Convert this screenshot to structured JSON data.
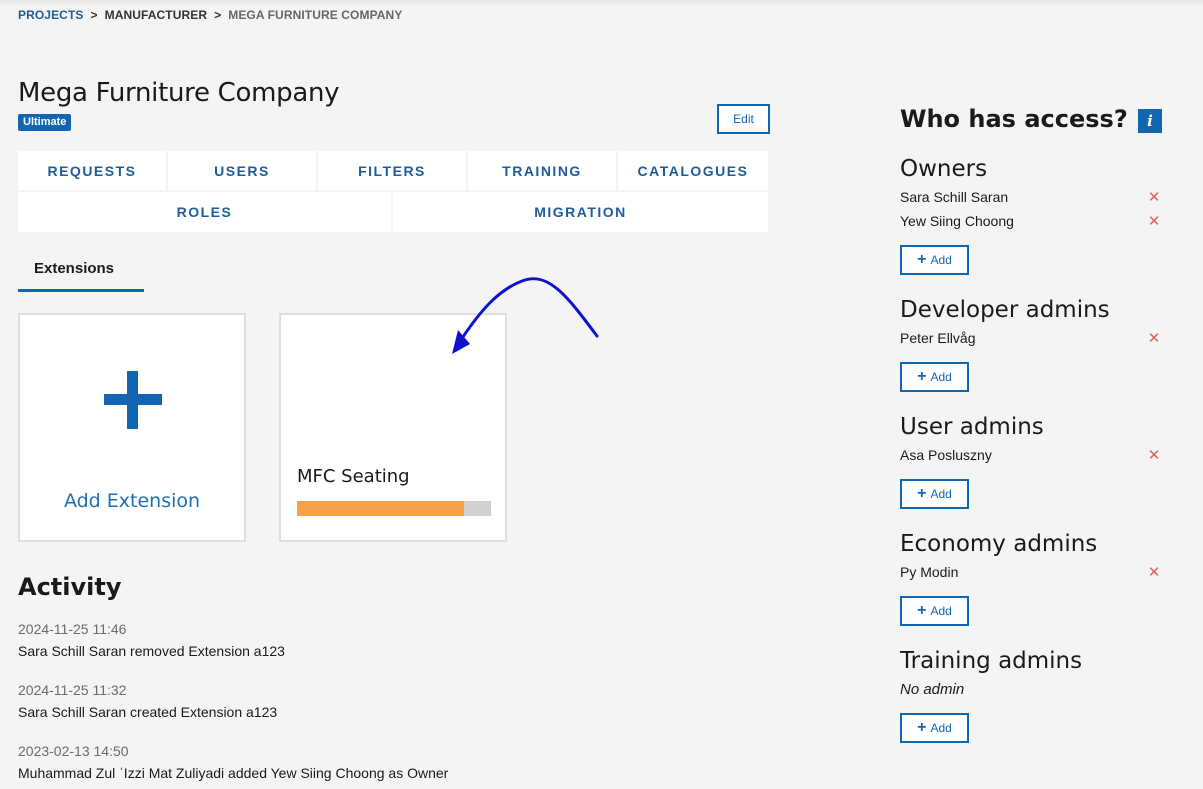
{
  "breadcrumb": {
    "projects": "PROJECTS",
    "manufacturer": "MANUFACTURER",
    "current": "MEGA FURNITURE COMPANY",
    "separator": ">"
  },
  "page": {
    "title": "Mega Furniture Company",
    "badge": "Ultimate",
    "edit_label": "Edit"
  },
  "nav": {
    "row1": [
      "REQUESTS",
      "USERS",
      "FILTERS",
      "TRAINING",
      "CATALOGUES"
    ],
    "row2": [
      "ROLES",
      "MIGRATION"
    ]
  },
  "tabs": {
    "extensions": "Extensions"
  },
  "extensions": {
    "add_label": "Add Extension",
    "cards": [
      {
        "name": "MFC Seating",
        "progress": 0.86
      }
    ]
  },
  "activity": {
    "title": "Activity",
    "items": [
      {
        "time": "2024-11-25 11:46",
        "text": "Sara Schill Saran removed Extension a123"
      },
      {
        "time": "2024-11-25 11:32",
        "text": "Sara Schill Saran created Extension a123"
      },
      {
        "time": "2023-02-13 14:50",
        "text": "Muhammad Zul ʿIzzi Mat Zuliyadi added Yew Siing Choong as Owner"
      }
    ]
  },
  "access": {
    "title": "Who has access?",
    "info_glyph": "i",
    "remove_glyph": "✕",
    "add_label": "Add",
    "groups": [
      {
        "title": "Owners",
        "members": [
          "Sara Schill Saran",
          "Yew Siing Choong"
        ]
      },
      {
        "title": "Developer admins",
        "members": [
          "Peter Ellvåg"
        ]
      },
      {
        "title": "User admins",
        "members": [
          "Asa Posluszny"
        ]
      },
      {
        "title": "Economy admins",
        "members": [
          "Py Modin"
        ]
      },
      {
        "title": "Training admins",
        "members": [],
        "empty_text": "No admin"
      }
    ]
  },
  "colors": {
    "accent": "#1266b0",
    "progress": "#f4a046",
    "remove": "#e06060",
    "annotation_arrow": "#1010d0"
  }
}
